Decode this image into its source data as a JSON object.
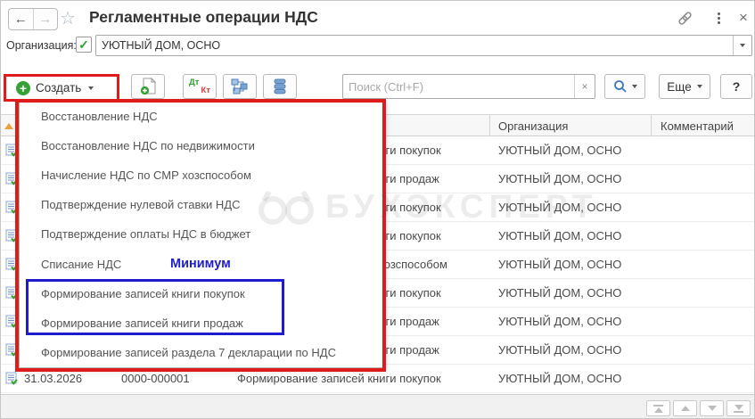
{
  "window": {
    "title": "Регламентные операции НДС"
  },
  "icons": {
    "back": "←",
    "forward": "→",
    "star": "☆",
    "close": "×",
    "check": "✓",
    "clear_x": "×"
  },
  "org_bar": {
    "label": "Организация:",
    "value": "УЮТНЫЙ ДОМ, ОСНО"
  },
  "toolbar": {
    "create_label": "Создать",
    "dt_label": "Дт",
    "kt_label": "Кт",
    "search_placeholder": "Поиск (Ctrl+F)",
    "more_label": "Еще",
    "help_label": "?"
  },
  "annotations": {
    "minimum_label": "Минимум",
    "red_color": "#e01b1b",
    "blue_color": "#1d1dcf"
  },
  "watermark": {
    "text": "БУХЭКСПЕРТ"
  },
  "menu": {
    "items": [
      "Восстановление НДС",
      "Восстановление НДС по недвижимости",
      "Начисление НДС по СМР хозспособом",
      "Подтверждение нулевой ставки НДС",
      "Подтверждение оплаты НДС в бюджет",
      "Списание НДС",
      "Формирование записей книги покупок",
      "Формирование записей книги продаж",
      "Формирование записей раздела 7 декларации по НДС"
    ]
  },
  "table": {
    "columns": {
      "organization": "Организация",
      "comment": "Комментарий"
    },
    "rows": [
      {
        "operation": "Формирование записей книги покупок",
        "organization": "УЮТНЫЙ ДОМ, ОСНО"
      },
      {
        "operation": "Формирование записей книги продаж",
        "organization": "УЮТНЫЙ ДОМ, ОСНО"
      },
      {
        "operation": "Формирование записей книги покупок",
        "organization": "УЮТНЫЙ ДОМ, ОСНО"
      },
      {
        "operation": "Формирование записей книги покупок",
        "organization": "УЮТНЫЙ ДОМ, ОСНО"
      },
      {
        "operation": "Начисление НДС по СМР хозспособом",
        "organization": "УЮТНЫЙ ДОМ, ОСНО"
      },
      {
        "operation": "Формирование записей книги покупок",
        "organization": "УЮТНЫЙ ДОМ, ОСНО"
      },
      {
        "operation": "Формирование записей книги продаж",
        "organization": "УЮТНЫЙ ДОМ, ОСНО"
      },
      {
        "operation": "Формирование записей книги продаж",
        "organization": "УЮТНЫЙ ДОМ, ОСНО"
      },
      {
        "date": "31.03.2026",
        "number": "0000-000001",
        "operation": "Формирование записей книги покупок",
        "organization": "УЮТНЫЙ ДОМ, ОСНО"
      }
    ]
  }
}
